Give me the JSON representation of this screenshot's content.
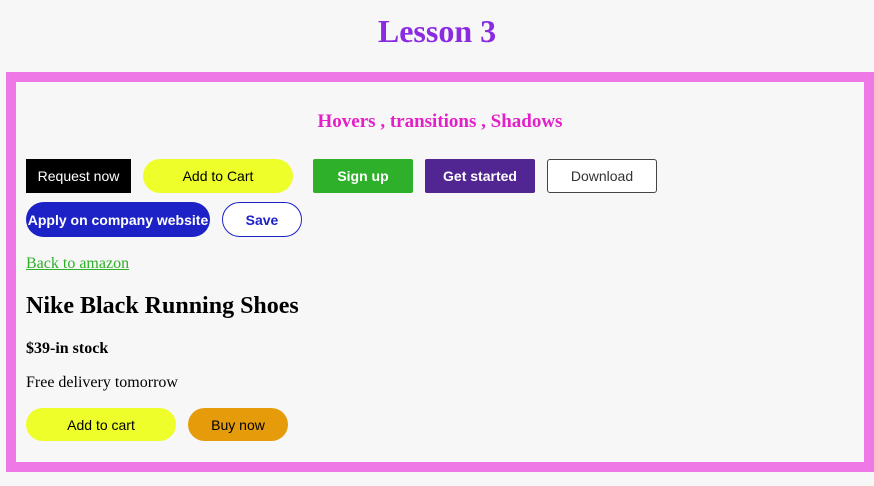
{
  "page": {
    "title": "Lesson 3"
  },
  "section": {
    "subtitle": "Hovers , transitions , Shadows"
  },
  "buttons": {
    "request_now": "Request now",
    "add_to_cart": "Add to Cart",
    "sign_up": "Sign up",
    "get_started": "Get started",
    "download": "Download",
    "apply_company": "Apply on company website",
    "save": "Save"
  },
  "link": {
    "back": "Back to amazon"
  },
  "product": {
    "name": "Nike Black Running Shoes",
    "price": "$39-in stock",
    "delivery": "Free delivery tomorrow",
    "add_to_cart": "Add to cart",
    "buy_now": "Buy now"
  },
  "colors": {
    "title": "#8a2be2",
    "frame_border": "#ee78e6",
    "subtitle": "#e31fc8",
    "yellow": "#eefe2a",
    "green": "#2fb02a",
    "purple": "#512592",
    "blue": "#1d22c6",
    "orange": "#e59b0a"
  }
}
